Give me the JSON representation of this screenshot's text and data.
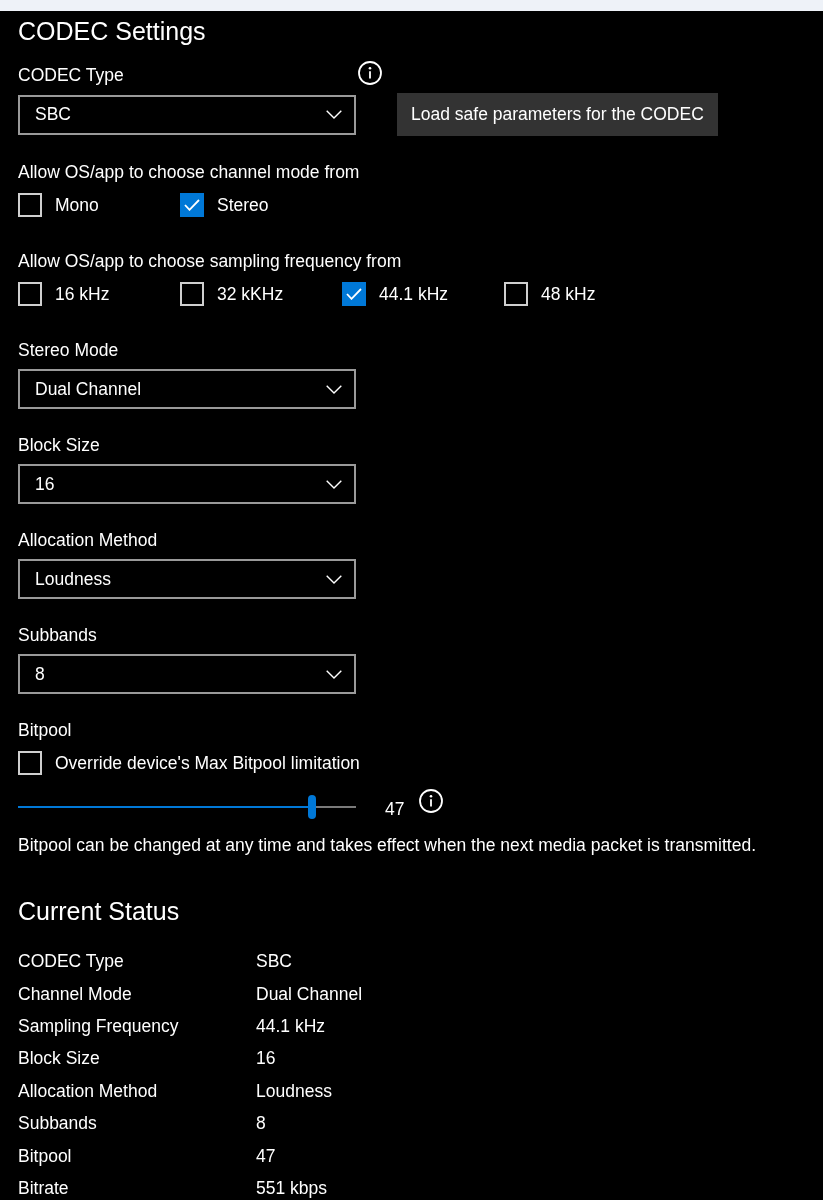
{
  "section_title": "CODEC Settings",
  "codec_type": {
    "label": "CODEC Type",
    "value": "SBC"
  },
  "load_button": "Load safe parameters for the CODEC",
  "channel_mode": {
    "label": "Allow OS/app to choose channel mode from",
    "options": [
      {
        "label": "Mono",
        "checked": false
      },
      {
        "label": "Stereo",
        "checked": true
      }
    ]
  },
  "sampling_frequency": {
    "label": "Allow OS/app to choose sampling frequency from",
    "options": [
      {
        "label": "16 kHz",
        "checked": false
      },
      {
        "label": "32 kKHz",
        "checked": false
      },
      {
        "label": "44.1 kHz",
        "checked": true
      },
      {
        "label": "48 kHz",
        "checked": false
      }
    ]
  },
  "dropdowns": [
    {
      "label": "Stereo Mode",
      "value": "Dual Channel"
    },
    {
      "label": "Block Size",
      "value": "16"
    },
    {
      "label": "Allocation Method",
      "value": "Loudness"
    },
    {
      "label": "Subbands",
      "value": "8"
    }
  ],
  "bitpool": {
    "label": "Bitpool",
    "override": {
      "label": "Override device's Max Bitpool limitation",
      "checked": false
    },
    "level": 0.87,
    "reading": "47",
    "note": "Bitpool can be changed at any time and takes effect when the next media packet is transmitted."
  },
  "status": {
    "title": "Current Status",
    "rows": [
      {
        "label": "CODEC Type",
        "value": "SBC"
      },
      {
        "label": "Channel Mode",
        "value": "Dual Channel"
      },
      {
        "label": "Sampling Frequency",
        "value": "44.1 kHz"
      },
      {
        "label": "Block Size",
        "value": "16"
      },
      {
        "label": "Allocation Method",
        "value": "Loudness"
      },
      {
        "label": "Subbands",
        "value": "8"
      },
      {
        "label": "Bitpool",
        "value": "47"
      },
      {
        "label": "Bitrate",
        "value": "551 kbps"
      }
    ]
  }
}
